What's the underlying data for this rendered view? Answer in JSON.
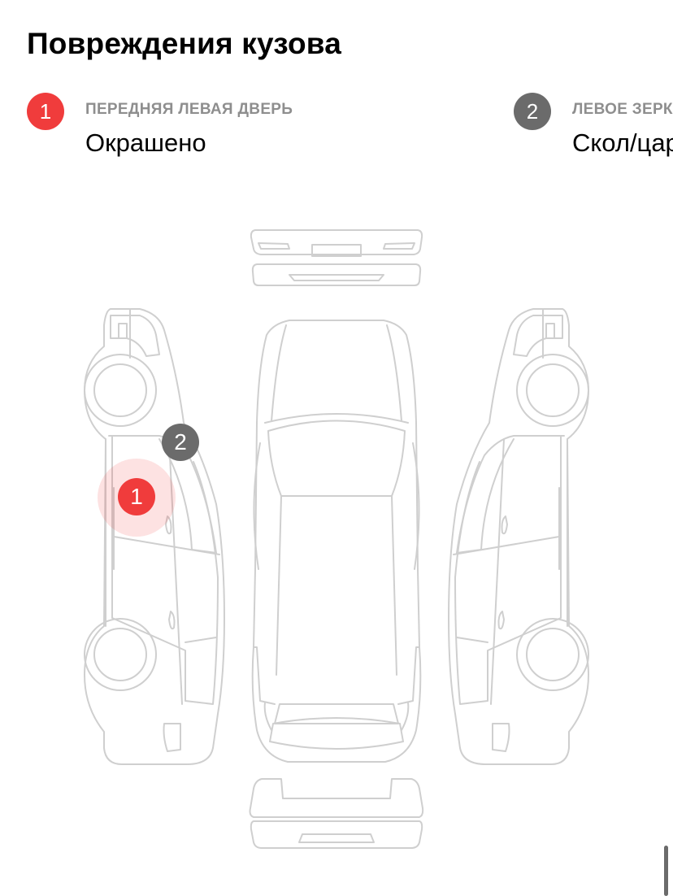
{
  "title": "Повреждения кузова",
  "colors": {
    "damage_red": "#f03c3c",
    "damage_gray": "#6b6b6b",
    "outline": "#cfcfcf"
  },
  "damages": [
    {
      "number": "1",
      "part": "ПЕРЕДНЯЯ ЛЕВАЯ ДВЕРЬ",
      "kind": "Окрашено",
      "color": "#f03c3c"
    },
    {
      "number": "2",
      "part": "ЛЕВОЕ ЗЕРКАЛО",
      "kind": "Скол/царапина",
      "color": "#6b6b6b"
    }
  ],
  "diagram": {
    "markers": [
      {
        "number": "1",
        "color": "#f03c3c",
        "highlighted": true
      },
      {
        "number": "2",
        "color": "#6b6b6b",
        "highlighted": false
      }
    ]
  }
}
